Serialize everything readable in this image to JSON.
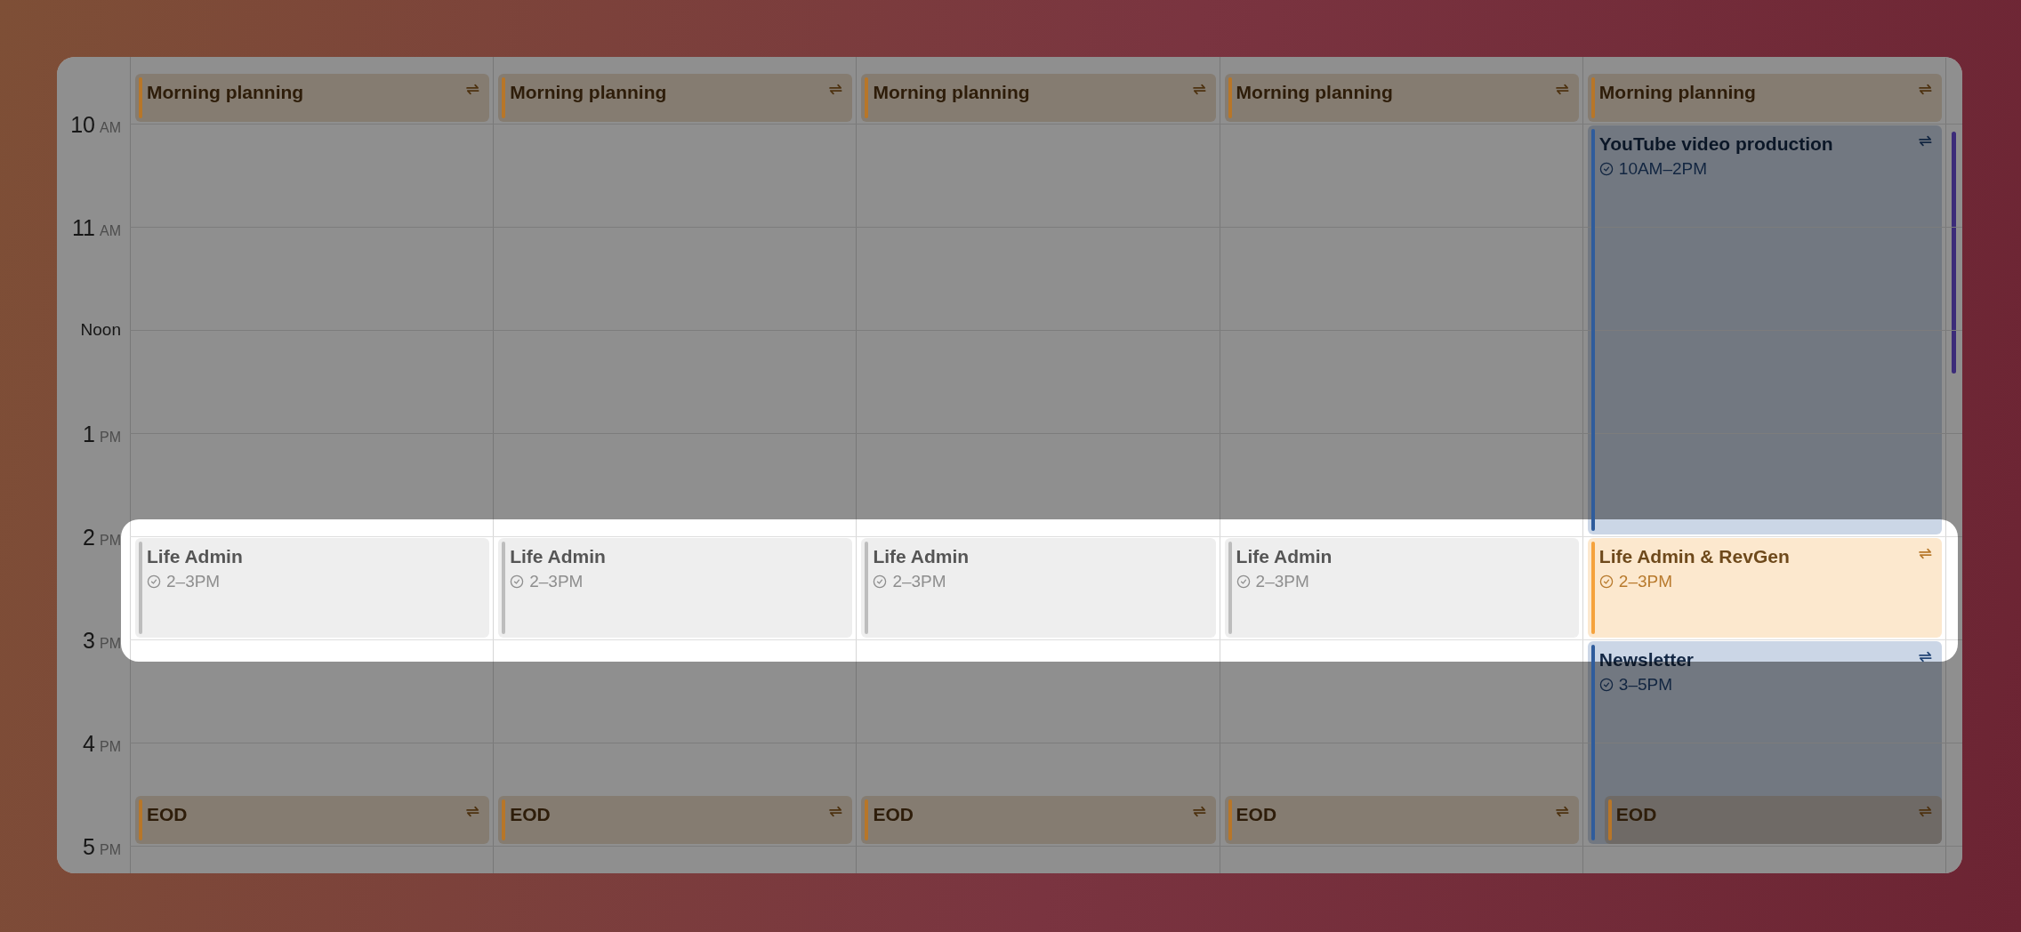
{
  "hours": [
    {
      "hour": "10",
      "period": "AM"
    },
    {
      "hour": "11",
      "period": "AM"
    },
    {
      "hour": "Noon"
    },
    {
      "hour": "1",
      "period": "PM"
    },
    {
      "hour": "2",
      "period": "PM"
    },
    {
      "hour": "3",
      "period": "PM"
    },
    {
      "hour": "4",
      "period": "PM"
    },
    {
      "hour": "5",
      "period": "PM"
    }
  ],
  "columns": [
    {
      "events": [
        {
          "title": "Morning planning",
          "color": "#b87628",
          "recurring": true
        },
        {
          "title": "Life Admin",
          "time": "2–3PM",
          "color": "#bdbdbd",
          "recurring": false
        },
        {
          "title": "EOD",
          "color": "#b87628",
          "recurring": true
        }
      ]
    },
    {
      "events": [
        {
          "title": "Morning planning",
          "color": "#b87628",
          "recurring": true
        },
        {
          "title": "Life Admin",
          "time": "2–3PM",
          "color": "#bdbdbd",
          "recurring": false
        },
        {
          "title": "EOD",
          "color": "#b87628",
          "recurring": true
        }
      ]
    },
    {
      "events": [
        {
          "title": "Morning planning",
          "color": "#b87628",
          "recurring": true
        },
        {
          "title": "Life Admin",
          "time": "2–3PM",
          "color": "#bdbdbd",
          "recurring": false
        },
        {
          "title": "EOD",
          "color": "#b87628",
          "recurring": true
        }
      ]
    },
    {
      "events": [
        {
          "title": "Morning planning",
          "color": "#b87628",
          "recurring": true
        },
        {
          "title": "Life Admin",
          "time": "2–3PM",
          "color": "#bdbdbd",
          "recurring": false
        },
        {
          "title": "EOD",
          "color": "#b87628",
          "recurring": true
        }
      ]
    },
    {
      "events": [
        {
          "title": "Morning planning",
          "color": "#b87628",
          "recurring": true
        },
        {
          "title": "YouTube video production",
          "time": "10AM–2PM",
          "color": "#2f5c9c",
          "recurring": true
        },
        {
          "title": "Life Admin & RevGen",
          "time": "2–3PM",
          "color": "#f5a23c",
          "recurring": true
        },
        {
          "title": "Newsletter",
          "time": "3–5PM",
          "color": "#2f5c9c",
          "recurring": true
        },
        {
          "title": "EOD",
          "color": "#b87628",
          "recurring": true
        }
      ]
    }
  ]
}
